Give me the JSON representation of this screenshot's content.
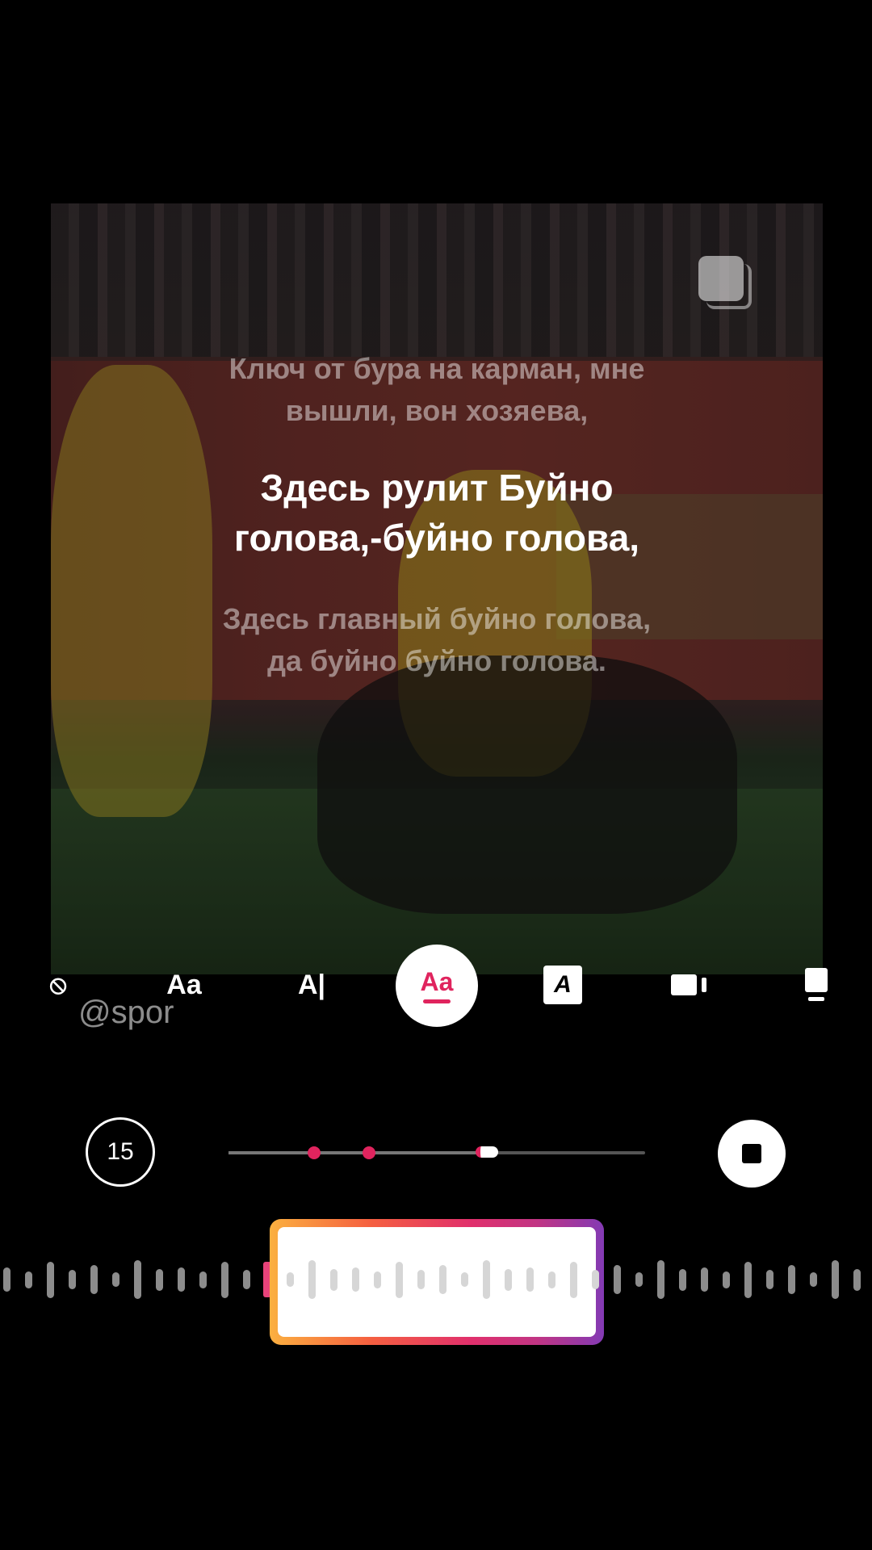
{
  "lyrics": {
    "prev_line_1": "Ключ от бура на карман, мне",
    "prev_line_2": "вышли, вон хозяева,",
    "current_line_1": "Здесь рулит Буйно",
    "current_line_2": "голова,-буйно голова,",
    "next_line_1": "Здесь главный буйно голова,",
    "next_line_2": "да буйно буйно голова."
  },
  "toolbar": {
    "none_icon": "⦸",
    "aa_label": "Aa",
    "ai_label": "A|",
    "selected_label": "Aa",
    "boxed_a_label": "A",
    "accent": "#e0245e"
  },
  "mention": "@spor",
  "playback": {
    "timer_value": "15",
    "progress": 0.61
  }
}
